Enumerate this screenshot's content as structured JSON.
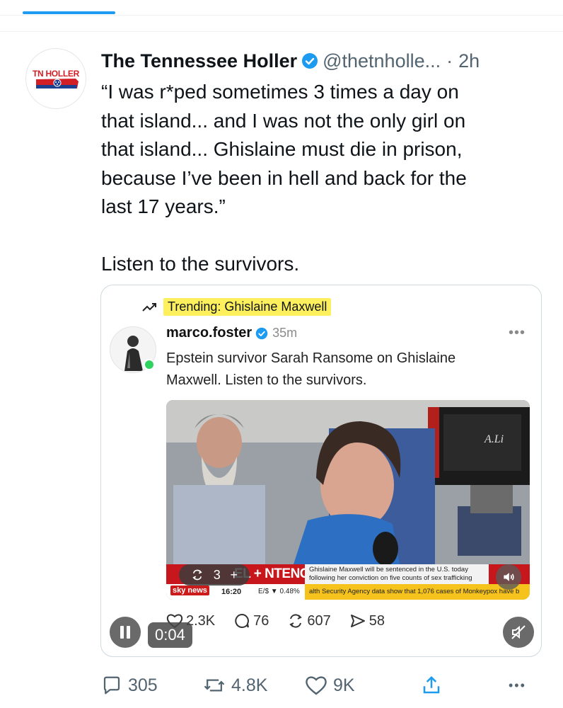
{
  "tweet": {
    "display_name": "The Tennessee Holler",
    "handle": "@thetnholle...",
    "separator": "·",
    "time": "2h",
    "avatar_text": "TN HOLLER",
    "text": "“I was r*ped sometimes 3 times a day on\nthat island... and I was not the only girl on\nthat island... Ghislaine must die in prison,\nbecause I’ve been in hell and back for the\nlast 17 years.”\n\nListen to the survivors."
  },
  "embed": {
    "trending": "Trending: Ghislaine Maxwell",
    "author": "marco.foster",
    "time": "35m",
    "more": "•••",
    "text": "Epstein survivor Sarah Ransome on Ghislaine Maxwell. Listen to the survivors.",
    "video": {
      "ticker_head": "EL + NTENCING",
      "ticker_sub": "Ghislaine Maxwell will be sentenced in the U.S. today following her conviction on five counts of sex trafficking",
      "sky_logo": "sky news",
      "clock": "16:20",
      "fx": "E/$ ▼ 0.48%",
      "newsline": "alth Security Agency data show that 1,076 cases of Monkeypox have b",
      "repost_count": "3",
      "repost_plus": "+",
      "sign_text": "A.Li"
    },
    "stats": {
      "likes": "2.3K",
      "comments": "76",
      "reposts": "607",
      "shares": "58"
    },
    "video_time": "0:04"
  },
  "actions": {
    "replies": "305",
    "reposts": "4.8K",
    "likes": "9K",
    "more": "•••"
  },
  "colors": {
    "accent": "#1d9bf0",
    "muted": "#536471",
    "highlight": "#fdf05c",
    "news_red": "#c7161c"
  }
}
